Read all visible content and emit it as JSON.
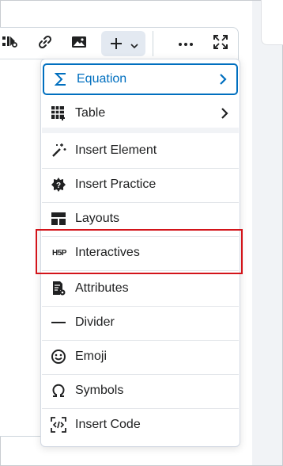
{
  "colors": {
    "accent": "#006fbf",
    "highlight": "#d3141a",
    "text": "#202122",
    "border": "#cdd5dc"
  },
  "toolbar": {
    "buttons": [
      {
        "name": "media-icon",
        "active": false
      },
      {
        "name": "link-icon",
        "active": false
      },
      {
        "name": "image-icon",
        "active": false
      },
      {
        "name": "insert-stuff-icon",
        "active": true,
        "has_dropdown": true
      },
      {
        "name": "more-icon",
        "active": false
      },
      {
        "name": "fullscreen-icon",
        "active": false
      }
    ]
  },
  "menu": {
    "items": [
      {
        "label": "Equation",
        "icon": "sigma-icon",
        "submenu": true,
        "focused": true
      },
      {
        "label": "Table",
        "icon": "table-icon",
        "submenu": true,
        "focused": false
      },
      {
        "label": "Insert Element",
        "icon": "magic-wand-icon",
        "submenu": false
      },
      {
        "label": "Insert Practice",
        "icon": "practice-icon",
        "submenu": false
      },
      {
        "label": "Layouts",
        "icon": "layouts-icon",
        "submenu": false
      },
      {
        "label": "Interactives",
        "icon": "h5p-icon",
        "icon_text": "H5P",
        "submenu": false,
        "highlighted": true
      },
      {
        "label": "Attributes",
        "icon": "attributes-icon",
        "submenu": false
      },
      {
        "label": "Divider",
        "icon": "divider-icon",
        "submenu": false
      },
      {
        "label": "Emoji",
        "icon": "emoji-icon",
        "submenu": false
      },
      {
        "label": "Symbols",
        "icon": "omega-icon",
        "submenu": false
      },
      {
        "label": "Insert Code",
        "icon": "code-icon",
        "submenu": false
      }
    ]
  }
}
